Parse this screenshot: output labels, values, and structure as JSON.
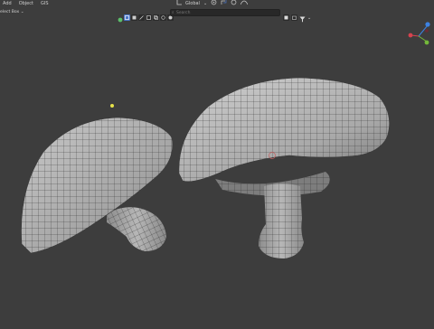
{
  "menu": {
    "items": [
      "Add",
      "Object",
      "GIS"
    ]
  },
  "header": {
    "orientation_label": "Global"
  },
  "toolbar": {
    "select_box_label": "elect Box",
    "search_placeholder": "Search"
  },
  "colors": {
    "accent": "#4b76c6",
    "viewport_bg": "#3d3d3d",
    "gizmo_x": "#d6434f",
    "gizmo_y": "#74b93a",
    "gizmo_z": "#3d82e2",
    "origin": "#e6e24a"
  }
}
